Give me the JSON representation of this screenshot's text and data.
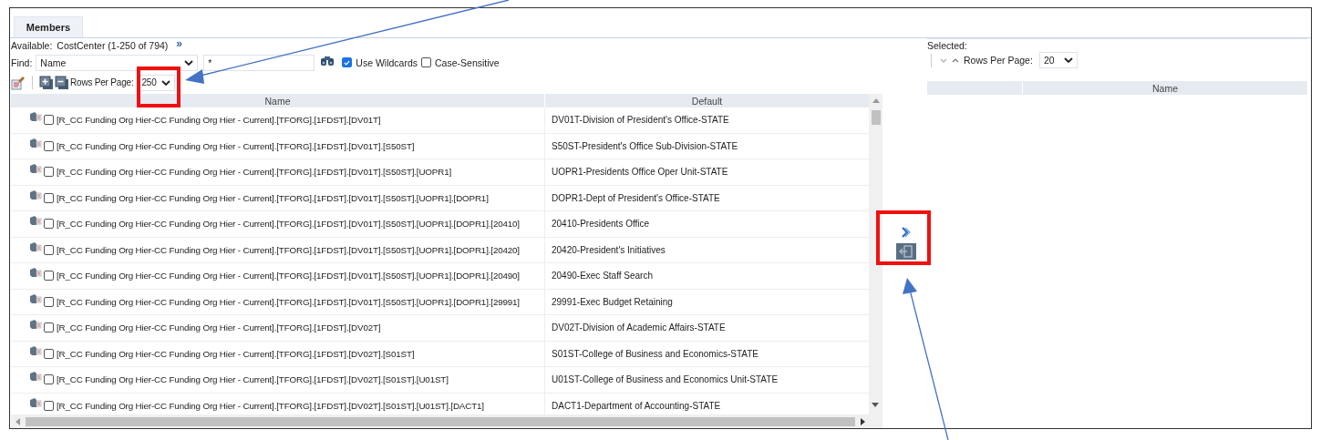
{
  "tab": {
    "label": "Members",
    "selected": true
  },
  "available": {
    "label": "Available:",
    "value": "CostCenter (1-250 of 794)",
    "expand": "»"
  },
  "find": {
    "label": "Find:",
    "field": "Name",
    "value": "*",
    "use_wildcards": {
      "label": "Use Wildcards",
      "checked": true
    },
    "case_sensitive": {
      "label": "Case-Sensitive",
      "checked": false
    }
  },
  "rows_per_page": {
    "label": "Rows Per Page:",
    "value": "250"
  },
  "table": {
    "columns": [
      "Name",
      "Default"
    ],
    "rows": [
      {
        "name": "[R_CC Funding Org Hier-CC Funding Org Hier - Current].[TFORG].[1FDST].[DV01T]",
        "default": "DV01T-Division of President's Office-STATE",
        "checked": false
      },
      {
        "name": "[R_CC Funding Org Hier-CC Funding Org Hier - Current].[TFORG].[1FDST].[DV01T].[S50ST]",
        "default": "S50ST-President's Office Sub-Division-STATE",
        "checked": false
      },
      {
        "name": "[R_CC Funding Org Hier-CC Funding Org Hier - Current].[TFORG].[1FDST].[DV01T].[S50ST].[UOPR1]",
        "default": "UOPR1-Presidents Office Oper Unit-STATE",
        "checked": false
      },
      {
        "name": "[R_CC Funding Org Hier-CC Funding Org Hier - Current].[TFORG].[1FDST].[DV01T].[S50ST].[UOPR1].[DOPR1]",
        "default": "DOPR1-Dept of President's Office-STATE",
        "checked": false
      },
      {
        "name": "[R_CC Funding Org Hier-CC Funding Org Hier - Current].[TFORG].[1FDST].[DV01T].[S50ST].[UOPR1].[DOPR1].[20410]",
        "default": "20410-Presidents Office",
        "checked": false
      },
      {
        "name": "[R_CC Funding Org Hier-CC Funding Org Hier - Current].[TFORG].[1FDST].[DV01T].[S50ST].[UOPR1].[DOPR1].[20420]",
        "default": "20420-President's Initiatives",
        "checked": false
      },
      {
        "name": "[R_CC Funding Org Hier-CC Funding Org Hier - Current].[TFORG].[1FDST].[DV01T].[S50ST].[UOPR1].[DOPR1].[20490]",
        "default": "20490-Exec Staff Search",
        "checked": false
      },
      {
        "name": "[R_CC Funding Org Hier-CC Funding Org Hier - Current].[TFORG].[1FDST].[DV01T].[S50ST].[UOPR1].[DOPR1].[29991]",
        "default": "29991-Exec Budget Retaining",
        "checked": false
      },
      {
        "name": "[R_CC Funding Org Hier-CC Funding Org Hier - Current].[TFORG].[1FDST].[DV02T]",
        "default": "DV02T-Division of Academic Affairs-STATE",
        "checked": false
      },
      {
        "name": "[R_CC Funding Org Hier-CC Funding Org Hier - Current].[TFORG].[1FDST].[DV02T].[S01ST]",
        "default": "S01ST-College of Business and Economics-STATE",
        "checked": false
      },
      {
        "name": "[R_CC Funding Org Hier-CC Funding Org Hier - Current].[TFORG].[1FDST].[DV02T].[S01ST].[U01ST]",
        "default": "U01ST-College of Business and Economics Unit-STATE",
        "checked": false
      },
      {
        "name": "[R_CC Funding Org Hier-CC Funding Org Hier - Current].[TFORG].[1FDST].[DV02T].[S01ST].[U01ST].[DACT1]",
        "default": "DACT1-Department of Accounting-STATE",
        "checked": false
      }
    ]
  },
  "selected_panel": {
    "label": "Selected:",
    "rows_per_page": {
      "label": "Rows Per Page:",
      "value": "20"
    },
    "columns": [
      "Name"
    ]
  }
}
